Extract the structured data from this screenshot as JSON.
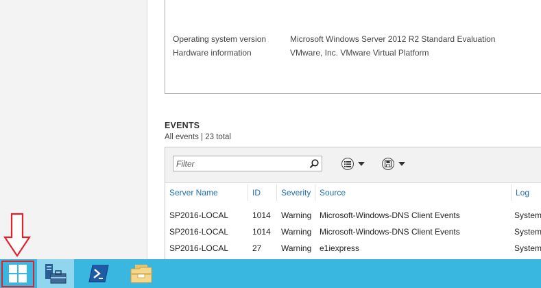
{
  "properties": [
    {
      "label": "Operating system version",
      "value": "Microsoft Windows Server 2012 R2 Standard Evaluation"
    },
    {
      "label": "Hardware information",
      "value": "VMware, Inc. VMware Virtual Platform"
    }
  ],
  "events": {
    "title": "EVENTS",
    "subtitle": "All events | 23 total",
    "filter_placeholder": "Filter",
    "columns": [
      "Server Name",
      "ID",
      "Severity",
      "Source",
      "Log"
    ],
    "rows": [
      {
        "server": "SP2016-LOCAL",
        "id": "1014",
        "severity": "Warning",
        "source": "Microsoft-Windows-DNS Client Events",
        "log": "System"
      },
      {
        "server": "SP2016-LOCAL",
        "id": "1014",
        "severity": "Warning",
        "source": "Microsoft-Windows-DNS Client Events",
        "log": "System"
      },
      {
        "server": "SP2016-LOCAL",
        "id": "27",
        "severity": "Warning",
        "source": "e1iexpress",
        "log": "System"
      }
    ]
  },
  "taskbar": {
    "items": [
      "windows-start",
      "server-manager",
      "powershell",
      "file-explorer"
    ],
    "highlight_color": "#e0222a",
    "bar_color": "#3ab7e0"
  }
}
